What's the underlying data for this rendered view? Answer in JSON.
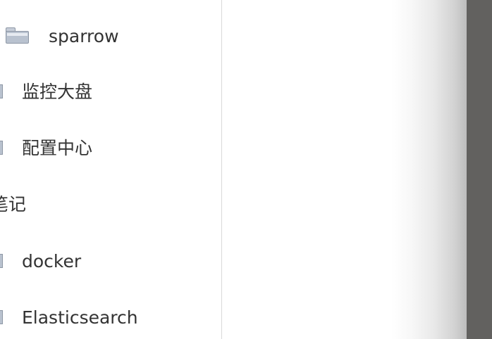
{
  "sidebar": {
    "items": [
      {
        "label": "sparrow",
        "icon": "folder-icon"
      },
      {
        "label": "监控大盘",
        "icon": "folder-icon"
      },
      {
        "label": "配置中心",
        "icon": "folder-icon"
      },
      {
        "label": "笔记",
        "icon": ""
      },
      {
        "label": "docker",
        "icon": "folder-icon"
      },
      {
        "label": "Elasticsearch",
        "icon": "folder-icon"
      }
    ]
  },
  "colors": {
    "folder_fill": "#b9c2cf",
    "folder_border": "#8d97a5",
    "text": "#333333",
    "divider": "#d9d9d9",
    "right_edge": "#62615f"
  }
}
